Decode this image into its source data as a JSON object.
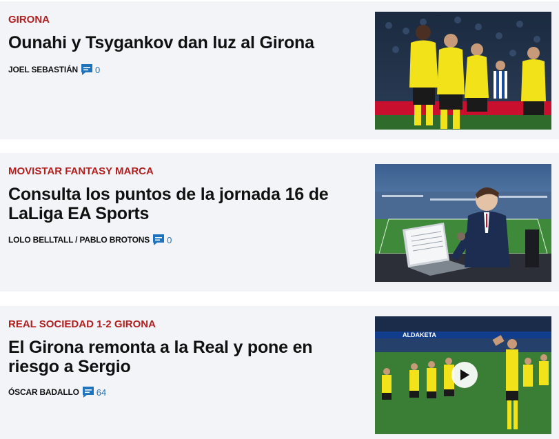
{
  "articles": [
    {
      "kicker": "GIRONA",
      "title": "Ounahi y Tsyganko​v dan luz al Girona",
      "author": "JOEL SEBASTIÁN",
      "comments": "0",
      "image": "girona-players-celebrating"
    },
    {
      "kicker": "MOVISTAR FANTASY MARCA",
      "title": "Consulta los puntos de la jornada 16 de LaLiga EA Sports",
      "author": "LOLO BELLTALL / PABLO BROTONS",
      "comments": "0",
      "image": "illustrated-analyst-laptop-stadium"
    },
    {
      "kicker": "REAL SOCIEDAD 1-2 GIRONA",
      "title": "El Girona remonta a la Real y pone en riesgo a Sergio",
      "author": "ÓSCAR BADALLO",
      "comments": "64",
      "image": "girona-players-pitch-video",
      "board_text": "ALDAKETA"
    }
  ],
  "colors": {
    "kicker": "#b11f1f",
    "comment_icon": "#1e73be",
    "card_bg": "#f3f4f8",
    "girona_yellow": "#f2e21a"
  }
}
